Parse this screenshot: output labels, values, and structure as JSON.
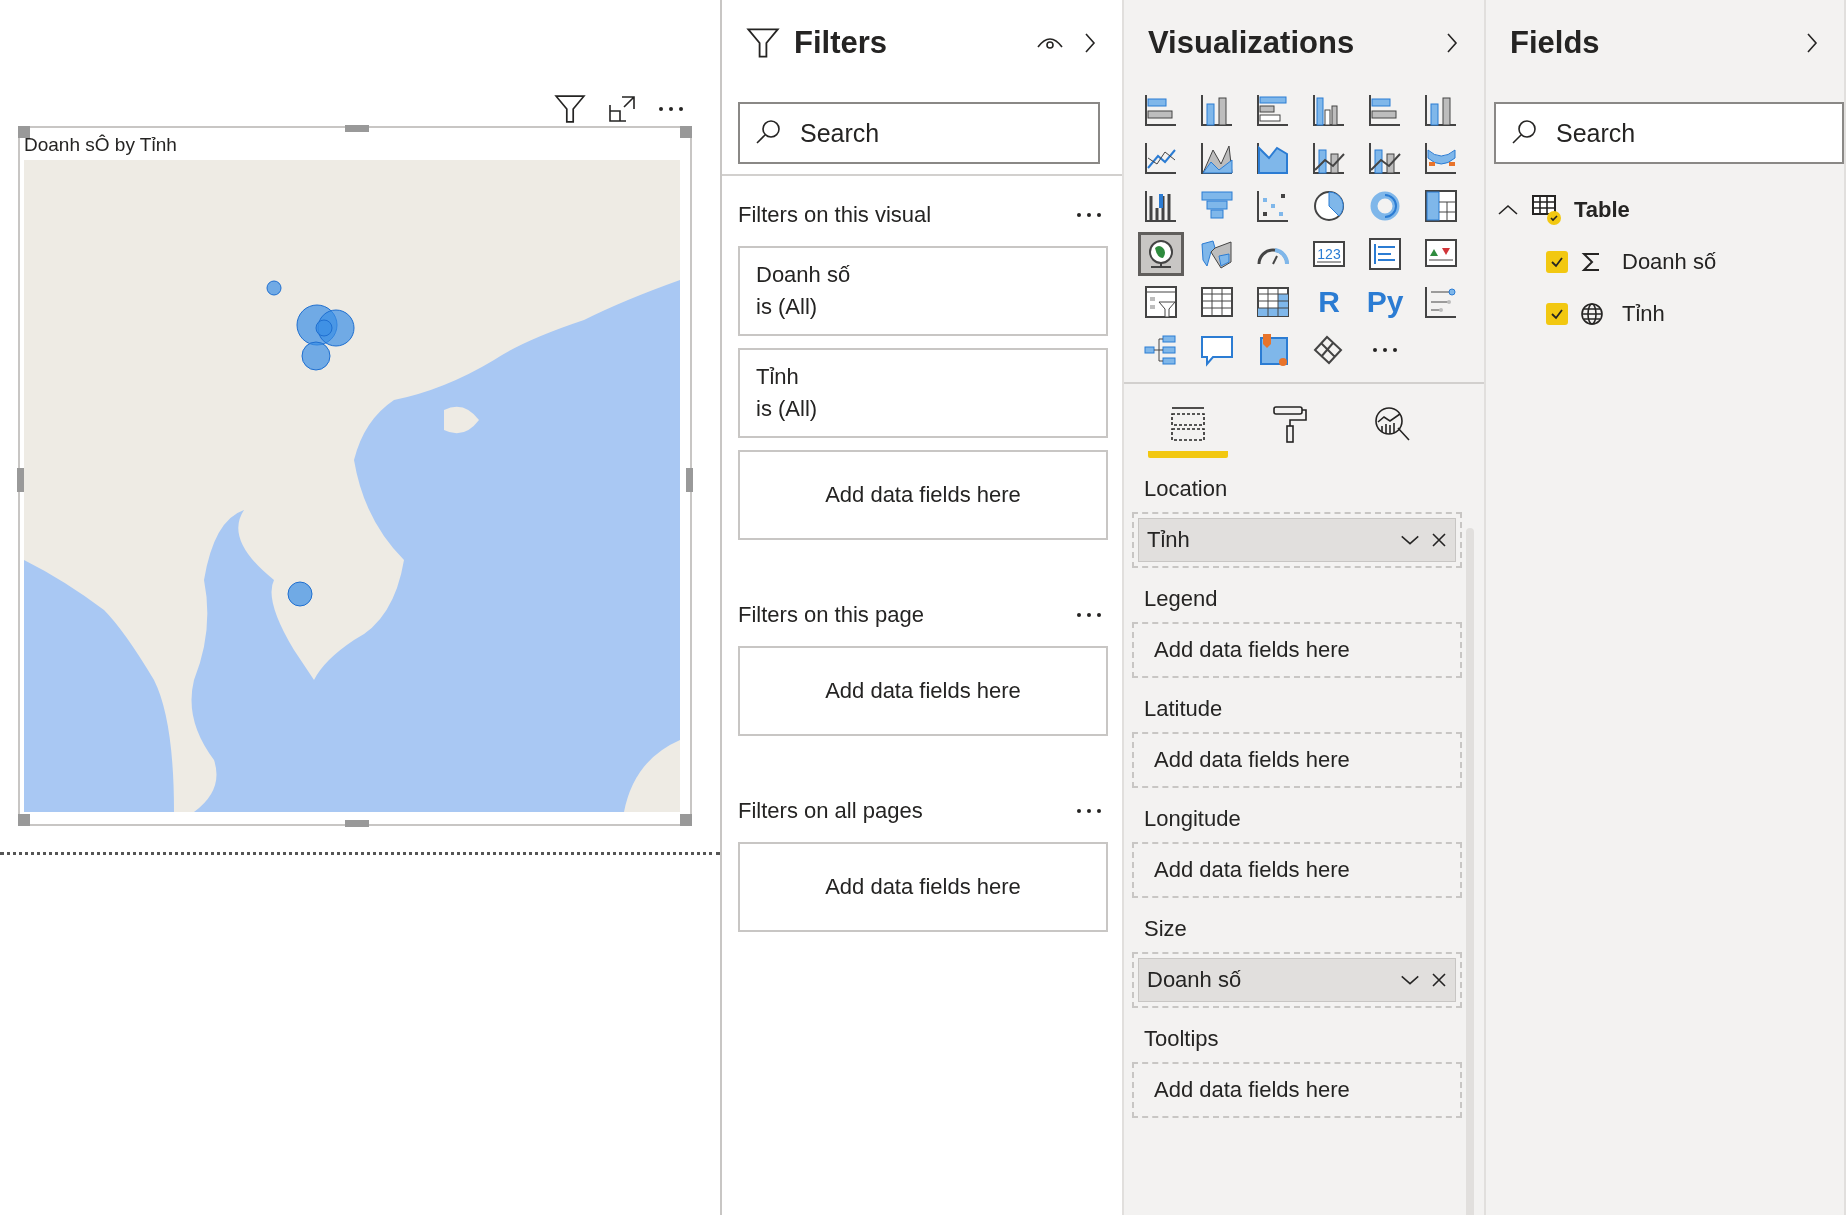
{
  "report_canvas": {
    "visual": {
      "title": "Doanh sÔ by Tỉnh"
    }
  },
  "filters_pane": {
    "title": "Filters",
    "search": {
      "placeholder": "Search"
    },
    "sections": [
      {
        "title": "Filters on this visual",
        "cards": [
          {
            "kind": "filter",
            "field": "Doanh số",
            "condition": "is (All)"
          },
          {
            "kind": "filter",
            "field": "Tỉnh",
            "condition": "is (All)"
          },
          {
            "kind": "drop",
            "label": "Add data fields here"
          }
        ]
      },
      {
        "title": "Filters on this page",
        "cards": [
          {
            "kind": "drop",
            "label": "Add data fields here"
          }
        ]
      },
      {
        "title": "Filters on all pages",
        "cards": [
          {
            "kind": "drop",
            "label": "Add data fields here"
          }
        ]
      }
    ]
  },
  "visualizations_pane": {
    "title": "Visualizations",
    "icons": [
      {
        "kind": "stacked-bar",
        "selected": false
      },
      {
        "kind": "stacked-column",
        "selected": false
      },
      {
        "kind": "clustered-bar",
        "selected": false
      },
      {
        "kind": "clustered-column",
        "selected": false
      },
      {
        "kind": "stacked-bar",
        "selected": false
      },
      {
        "kind": "stacked-column",
        "selected": false
      },
      {
        "kind": "line",
        "selected": false
      },
      {
        "kind": "area",
        "selected": false
      },
      {
        "kind": "stacked-area",
        "selected": false
      },
      {
        "kind": "combo",
        "selected": false
      },
      {
        "kind": "combo",
        "selected": false
      },
      {
        "kind": "ribbon",
        "selected": false
      },
      {
        "kind": "waterfall",
        "selected": false
      },
      {
        "kind": "funnel",
        "selected": false
      },
      {
        "kind": "scatter",
        "selected": false
      },
      {
        "kind": "pie",
        "selected": false
      },
      {
        "kind": "donut",
        "selected": false
      },
      {
        "kind": "treemap",
        "selected": false
      },
      {
        "kind": "globe",
        "selected": true
      },
      {
        "kind": "filled-map",
        "selected": false
      },
      {
        "kind": "gauge",
        "selected": false
      },
      {
        "kind": "card",
        "label": "123",
        "selected": false
      },
      {
        "kind": "multirow-card",
        "selected": false
      },
      {
        "kind": "kpi",
        "selected": false
      },
      {
        "kind": "slicer",
        "selected": false
      },
      {
        "kind": "table",
        "selected": false
      },
      {
        "kind": "matrix",
        "selected": false
      },
      {
        "kind": "text",
        "label": "R",
        "selected": false
      },
      {
        "kind": "text",
        "label": "Py",
        "selected": false
      },
      {
        "kind": "influencers",
        "selected": false
      },
      {
        "kind": "decomposition",
        "selected": false
      },
      {
        "kind": "speech",
        "selected": false
      },
      {
        "kind": "pin-map",
        "selected": false
      },
      {
        "kind": "diamond",
        "selected": false
      },
      {
        "kind": "more",
        "selected": false
      }
    ],
    "tabs": [
      {
        "kind": "fields",
        "selected": true
      },
      {
        "kind": "format",
        "selected": false
      },
      {
        "kind": "analytics",
        "selected": false
      }
    ],
    "wells": [
      {
        "label": "Location",
        "field": "Tỉnh"
      },
      {
        "label": "Legend",
        "empty_text": "Add data fields here"
      },
      {
        "label": "Latitude",
        "empty_text": "Add data fields here"
      },
      {
        "label": "Longitude",
        "empty_text": "Add data fields here"
      },
      {
        "label": "Size",
        "field": "Doanh số"
      },
      {
        "label": "Tooltips",
        "empty_text": "Add data fields here"
      }
    ]
  },
  "fields_pane": {
    "title": "Fields",
    "search": {
      "placeholder": "Search"
    },
    "tables": [
      {
        "name": "Table",
        "expanded": true,
        "fields": [
          {
            "name": "Doanh số",
            "kind": "measure",
            "checked": true
          },
          {
            "name": "Tỉnh",
            "kind": "geo",
            "checked": true
          }
        ]
      }
    ]
  }
}
